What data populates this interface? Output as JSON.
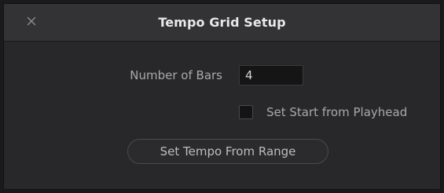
{
  "dialog": {
    "title": "Tempo Grid Setup",
    "close_icon": "close-icon"
  },
  "fields": {
    "bars_label": "Number of Bars",
    "bars_value": "4",
    "start_label": "Set Start from Playhead",
    "start_checked": false
  },
  "buttons": {
    "range_label": "Set Tempo From Range"
  },
  "colors": {
    "background": "#28282a",
    "titlebar": "#333336",
    "text": "#a9a9ab",
    "title_text": "#e9e9e9"
  }
}
